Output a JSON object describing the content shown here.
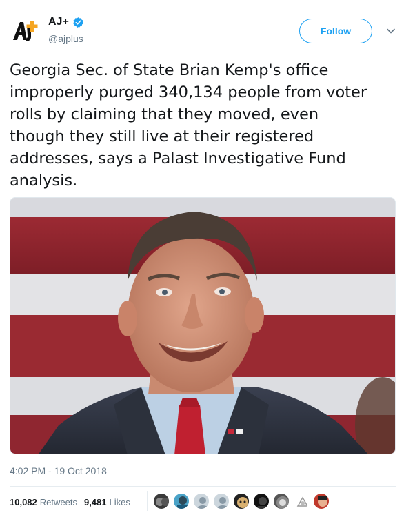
{
  "account": {
    "display_name": "AJ+",
    "handle": "@ajplus",
    "verified": true,
    "logo_text": "AJ+"
  },
  "follow_button": {
    "label": "Follow"
  },
  "tweet": {
    "lines": [
      "Georgia Sec. of State Brian Kemp's office",
      "improperly purged 340,134 people from voter",
      "rolls by claiming that they moved, even",
      "though they still live at their registered",
      "addresses, says a Palast Investigative Fund",
      "analysis."
    ],
    "timestamp": "4:02 PM - 19 Oct 2018"
  },
  "stats": {
    "retweets_count": "10,082",
    "retweets_label": "Retweets",
    "likes_count": "9,481",
    "likes_label": "Likes"
  },
  "colors": {
    "accent": "#1da1f2",
    "verified": "#1da1f2",
    "secondary_text": "#657786",
    "primary_text": "#14171a"
  },
  "icons": [
    "aj-plus-logo",
    "verified-badge-icon",
    "chevron-down-icon"
  ]
}
